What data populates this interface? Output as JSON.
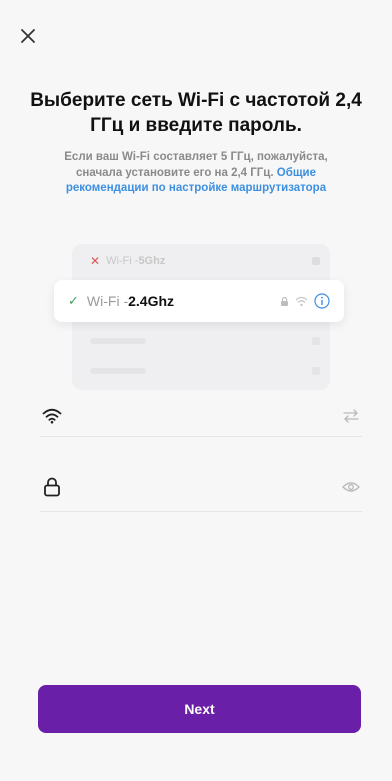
{
  "header": {
    "close_icon": "close-icon"
  },
  "title": "Выберите сеть Wi-Fi с частотой 2,4 ГГц и введите пароль.",
  "subtitle": {
    "text": "Если ваш Wi-Fi составляет 5 ГГц, пожалуйста, сначала установите его на 2,4 ГГц.",
    "link": "Общие рекомендации по настройке маршрутизатора"
  },
  "illustration": {
    "row_5g": {
      "prefix": "Wi-Fi - ",
      "band": "5Ghz"
    },
    "row_24": {
      "prefix": "Wi-Fi - ",
      "band": "2.4Ghz"
    }
  },
  "fields": {
    "wifi": {
      "value": "",
      "leading_icon": "wifi-icon",
      "trailing_icon": "switch-network-icon"
    },
    "password": {
      "value": "",
      "leading_icon": "lock-icon",
      "trailing_icon": "eye-icon"
    }
  },
  "buttons": {
    "next": "Next"
  },
  "colors": {
    "accent": "#6a1fa8",
    "link": "#3d8fe0",
    "check": "#3aa35a",
    "cross": "#e05555"
  }
}
